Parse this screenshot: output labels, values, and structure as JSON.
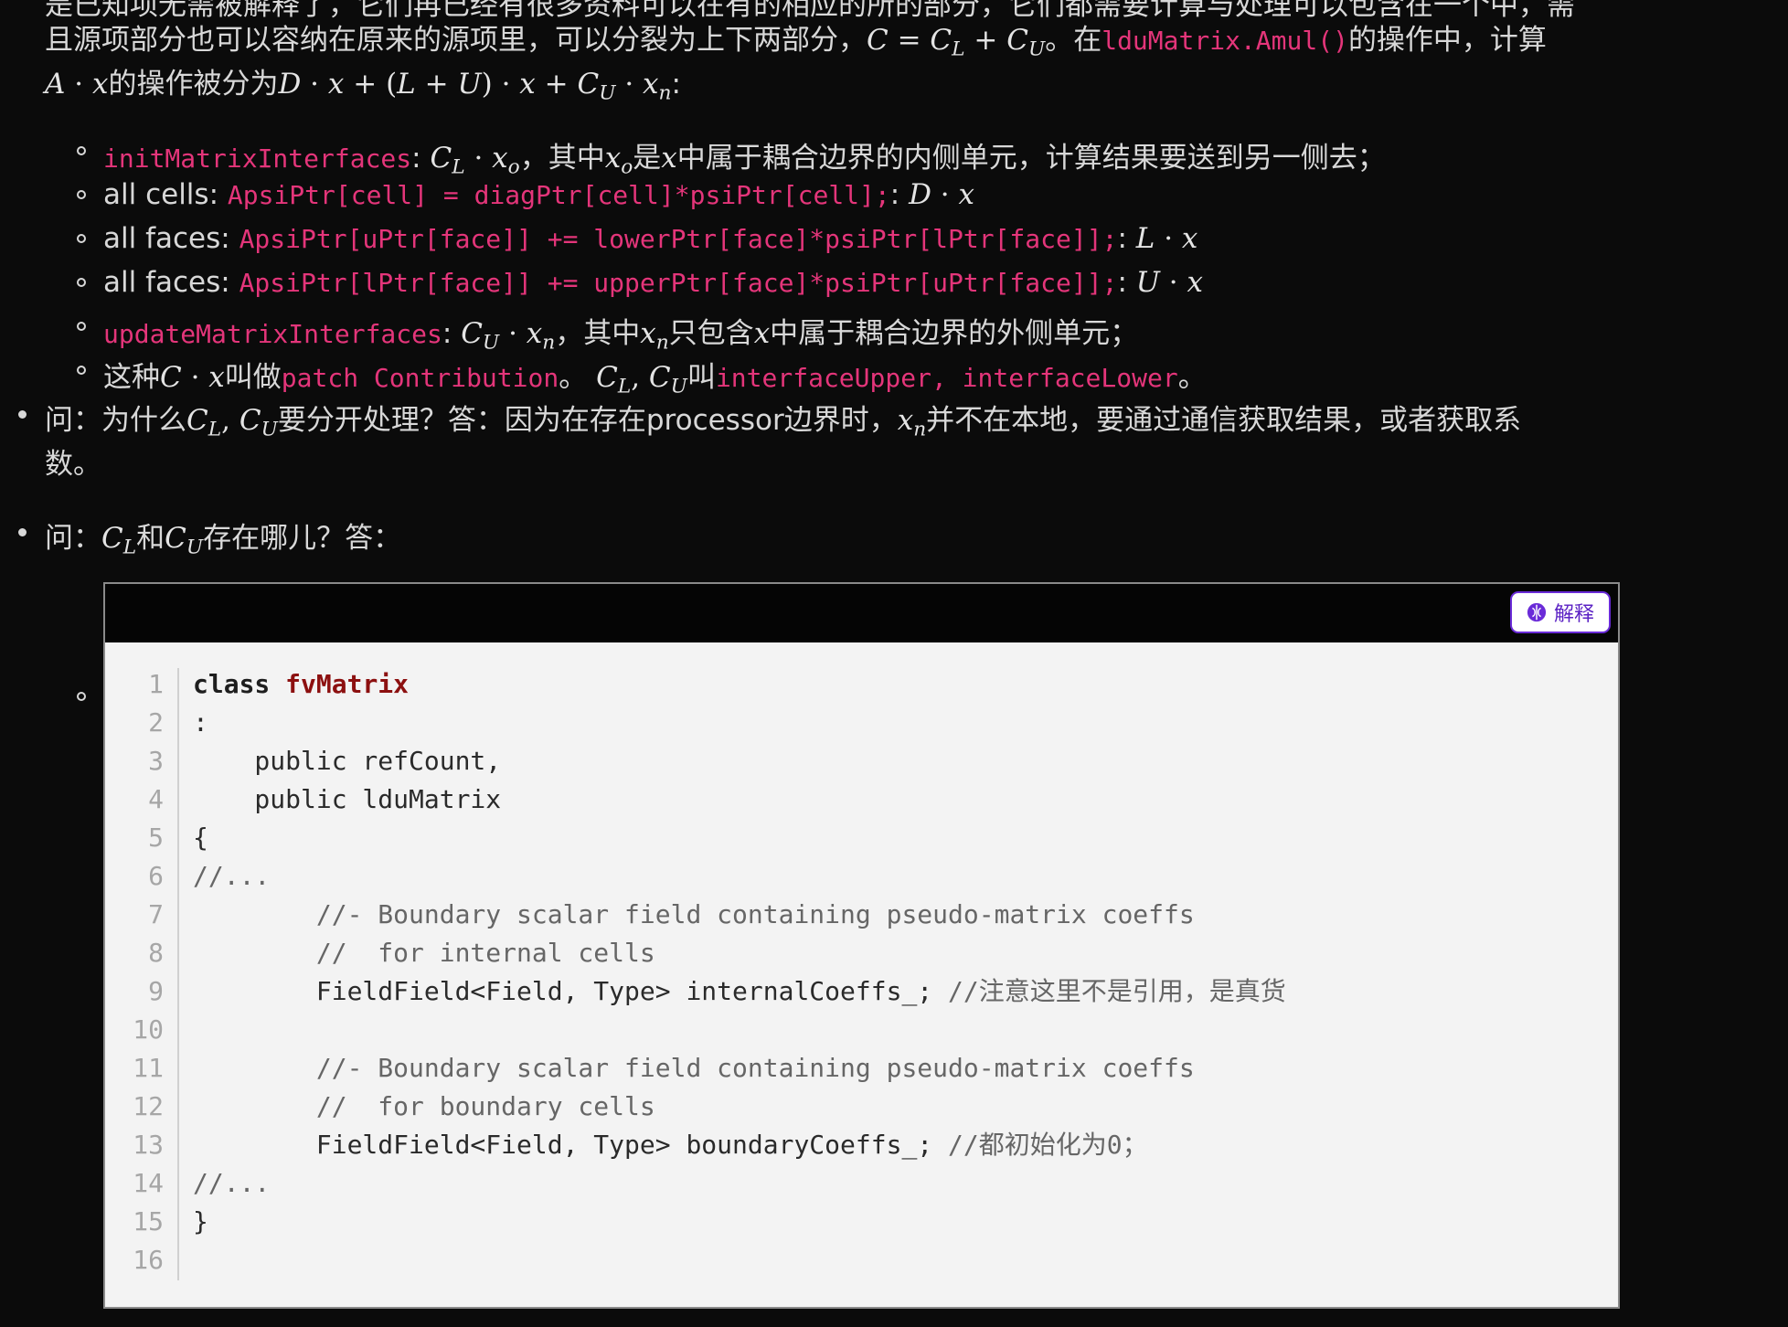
{
  "top_para": {
    "line1_partial": "是已知项无需被解释了，它们再已经有很多资料可以在有的相应的所的部分，它们都需要计算与处理可以包含在一个中，需",
    "line2_a": "且源项部分也可以容纳在原来的源项里，可以分裂为上下两部分，",
    "line2_math": "C = C_L + C_U",
    "line2_b": "。在",
    "line2_code": "lduMatrix.Amul()",
    "line2_c": "的操作中，计算",
    "line3_math_a": "A · x",
    "line3_a": "的操作被分为",
    "line3_math_b": "D · x + (L + U) · x + C_U · x_n",
    "line3_b": ":"
  },
  "sub_items": [
    {
      "code": "initMatrixInterfaces",
      "text": ": C_L · x_o，其中x_o是x中属于耦合边界的内侧单元，计算结果要送到另一侧去；"
    },
    {
      "label": "all cells: ",
      "code": "ApsiPtr[cell] = diagPtr[cell]*psiPtr[cell];",
      "text": ": D · x"
    },
    {
      "label": "all faces: ",
      "code": "ApsiPtr[uPtr[face]] += lowerPtr[face]*psiPtr[lPtr[face]];",
      "text": ": L · x"
    },
    {
      "label": "all faces: ",
      "code": "ApsiPtr[lPtr[face]] += upperPtr[face]*psiPtr[uPtr[face]];",
      "text": ": U · x"
    },
    {
      "code": "updateMatrixInterfaces",
      "text": ": C_U · x_n，其中x_n只包含x中属于耦合边界的外侧单元；"
    },
    {
      "label": "这种C · x叫做",
      "code": "patch Contribution",
      "text": "。 C_L, C_U叫",
      "code2": "interfaceUpper",
      "sep": ", ",
      "code3": "interfaceLower",
      "end": "。"
    }
  ],
  "q1": {
    "line1_a": "问：为什么",
    "line1_b": "要分开处理？答：因为在存在processor边界时，",
    "line1_c": "并不在本地，要通过通信获取结果，或者获取系",
    "line2": "数。"
  },
  "q2": {
    "a": "问：",
    "b": "和",
    "c": "存在哪儿？答："
  },
  "code_block": {
    "button_label": "解释",
    "lines": [
      {
        "n": "1",
        "text": "class fvMatrix"
      },
      {
        "n": "2",
        "text": ":"
      },
      {
        "n": "3",
        "text": "    public refCount,"
      },
      {
        "n": "4",
        "text": "    public lduMatrix"
      },
      {
        "n": "5",
        "text": "{"
      },
      {
        "n": "6",
        "text": "//..."
      },
      {
        "n": "7",
        "text": "        //- Boundary scalar field containing pseudo-matrix coeffs"
      },
      {
        "n": "8",
        "text": "        //  for internal cells"
      },
      {
        "n": "9",
        "text": "        FieldField<Field, Type> internalCoeffs_; //注意这里不是引用，是真货"
      },
      {
        "n": "10",
        "text": ""
      },
      {
        "n": "11",
        "text": "        //- Boundary scalar field containing pseudo-matrix coeffs"
      },
      {
        "n": "12",
        "text": "        //  for boundary cells"
      },
      {
        "n": "13",
        "text": "        FieldField<Field, Type> boundaryCoeffs_; //都初始化为0；"
      },
      {
        "n": "14",
        "text": "//..."
      },
      {
        "n": "15",
        "text": "}"
      },
      {
        "n": "16",
        "text": ""
      }
    ]
  },
  "colors": {
    "inline_code": "#e4357a",
    "class_name": "#8c1010",
    "button": "#6a2bd8"
  }
}
